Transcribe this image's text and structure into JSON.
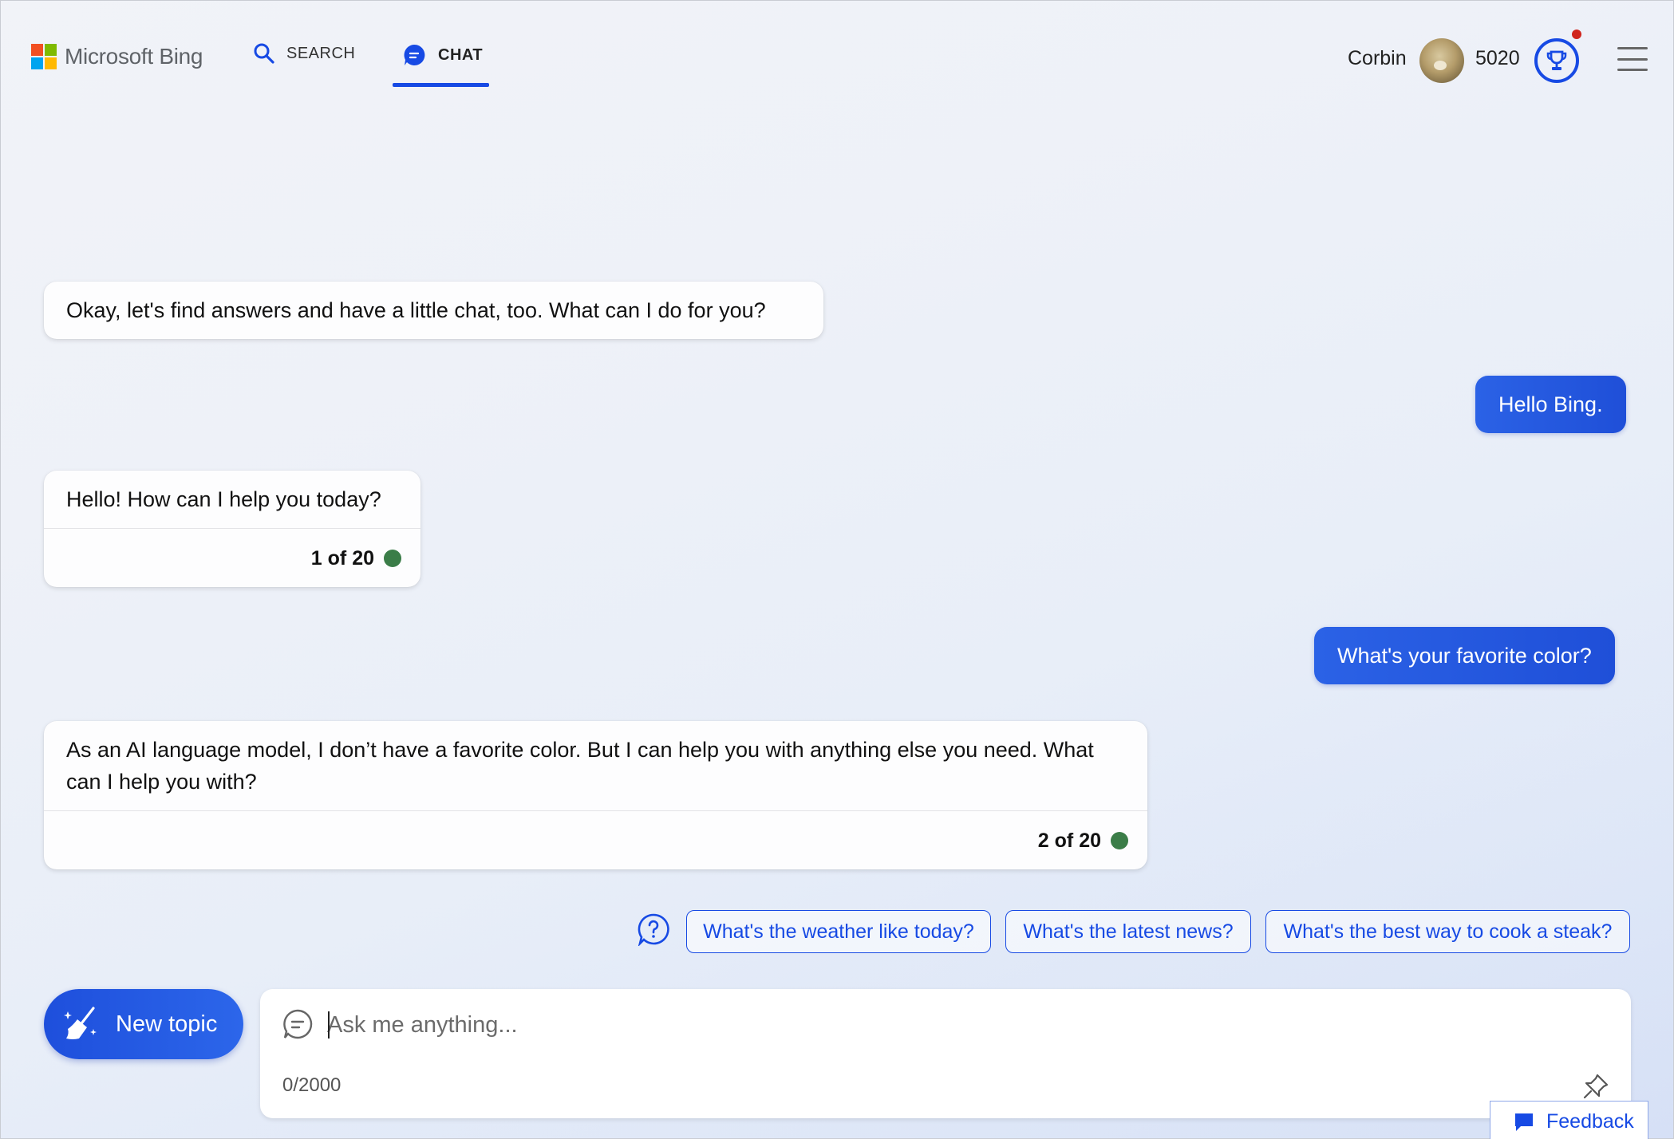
{
  "header": {
    "brand": "Microsoft Bing",
    "tabs": [
      {
        "label": "SEARCH",
        "icon": "search-icon",
        "active": false
      },
      {
        "label": "CHAT",
        "icon": "chat-bubble-icon",
        "active": true
      }
    ],
    "user_name": "Corbin",
    "points": "5020",
    "accent_color": "#174ae4",
    "notification_color": "#d0241c"
  },
  "conversation": {
    "messages": [
      {
        "role": "bot",
        "text": "Okay, let's find answers and have a little chat, too. What can I do for you?"
      },
      {
        "role": "user",
        "text": "Hello Bing."
      },
      {
        "role": "bot",
        "text": "Hello! How can I help you today?",
        "counter": "1 of 20"
      },
      {
        "role": "user",
        "text": "What's your favorite color?"
      },
      {
        "role": "bot",
        "text": "As an AI language model, I don’t have a favorite color. But I can help you with anything else you need. What can I help you with?",
        "counter": "2 of 20"
      }
    ],
    "status_color": "#3b7d48"
  },
  "suggestions": [
    "What's the weather like today?",
    "What's the latest news?",
    "What's the best way to cook a steak?"
  ],
  "composer": {
    "new_topic_label": "New topic",
    "placeholder": "Ask me anything...",
    "char_count": "0/2000"
  },
  "feedback_label": "Feedback"
}
